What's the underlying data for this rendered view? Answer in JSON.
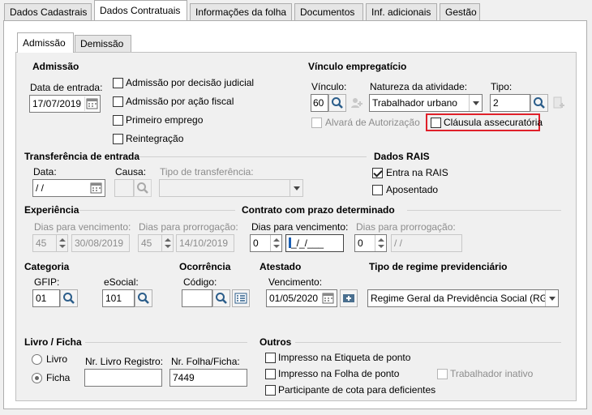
{
  "top_tabs": [
    "Dados Cadastrais",
    "Dados Contratuais",
    "Informações da folha",
    "Documentos",
    "Inf. adicionais",
    "Gestão"
  ],
  "sub_tabs": [
    "Admissão",
    "Demissão"
  ],
  "admissao": {
    "title": "Admissão",
    "data_entrada_label": "Data de entrada:",
    "data_entrada": "17/07/2019",
    "opt_decisao": "Admissão por decisão judicial",
    "opt_fiscal": "Admissão por ação fiscal",
    "opt_primeiro": "Primeiro emprego",
    "opt_reintegracao": "Reintegração"
  },
  "vinculo": {
    "title": "Vínculo empregatício",
    "vinculo_label": "Vínculo:",
    "vinculo_value": "60",
    "natureza_label": "Natureza da atividade:",
    "natureza_value": "Trabalhador urbano",
    "tipo_label": "Tipo:",
    "tipo_value": "2",
    "alvara": "Alvará de Autorização",
    "clausula": "Cláusula assecuratória",
    "highlight_color": "#e0202a"
  },
  "transferencia": {
    "title": "Transferência de entrada",
    "data_label": "Data:",
    "data_value": " / /",
    "causa_label": "Causa:",
    "tipo_label": "Tipo de transferência:"
  },
  "rais": {
    "title": "Dados RAIS",
    "entra": "Entra na RAIS",
    "aposentado": "Aposentado"
  },
  "experiencia": {
    "title": "Experiência",
    "venc_label": "Dias para vencimento:",
    "venc_days": "45",
    "venc_date": "30/08/2019",
    "prorr_label": "Dias para prorrogação:",
    "prorr_days": "45",
    "prorr_date": "14/10/2019"
  },
  "contrato": {
    "title": "Contrato com prazo determinado",
    "venc_label": "Dias para vencimento:",
    "venc_days": "0",
    "venc_date": "_/_/___",
    "prorr_label": "Dias para prorrogação:",
    "prorr_days": "0",
    "prorr_date": " / /"
  },
  "categoria": {
    "title": "Categoria",
    "gfip_label": "GFIP:",
    "gfip": "01",
    "esocial_label": "eSocial:",
    "esocial": "101"
  },
  "ocorrencia": {
    "title": "Ocorrência",
    "codigo_label": "Código:",
    "codigo": ""
  },
  "atestado": {
    "title": "Atestado",
    "venc_label": "Vencimento:",
    "venc": "01/05/2020"
  },
  "regime": {
    "title": "Tipo de regime previdenciário",
    "value": "Regime Geral da Previdência Social (RGP"
  },
  "livro": {
    "title": "Livro / Ficha",
    "livro": "Livro",
    "ficha": "Ficha",
    "nr_livro_label": "Nr. Livro Registro:",
    "nr_livro": "",
    "nr_folha_label": "Nr. Folha/Ficha:",
    "nr_folha": "7449"
  },
  "outros": {
    "title": "Outros",
    "etiqueta": "Impresso na Etiqueta de ponto",
    "folha": "Impresso na Folha de ponto",
    "inativo": "Trabalhador inativo",
    "cota": "Participante de cota para deficientes"
  }
}
